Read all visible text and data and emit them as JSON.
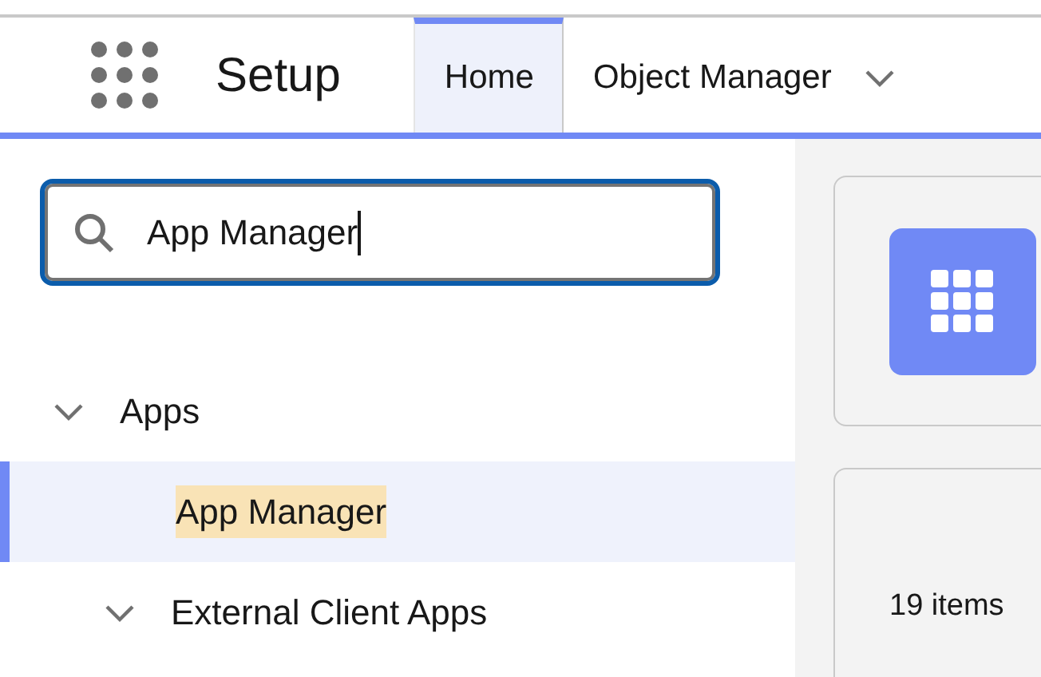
{
  "header": {
    "title": "Setup",
    "tabs": [
      {
        "label": "Home",
        "selected": true,
        "has_menu": false
      },
      {
        "label": "Object Manager",
        "selected": false,
        "has_menu": true
      }
    ]
  },
  "search": {
    "value": "App Manager",
    "focused": true
  },
  "tree": [
    {
      "label": "Apps",
      "expanded": true,
      "selected": false,
      "highlighted": false,
      "children": [
        {
          "label": "App Manager",
          "selected": true,
          "highlighted": true
        },
        {
          "label": "External Client Apps",
          "expanded": true,
          "selected": false,
          "highlighted": false
        }
      ]
    }
  ],
  "content": {
    "item_count": "19 items"
  }
}
